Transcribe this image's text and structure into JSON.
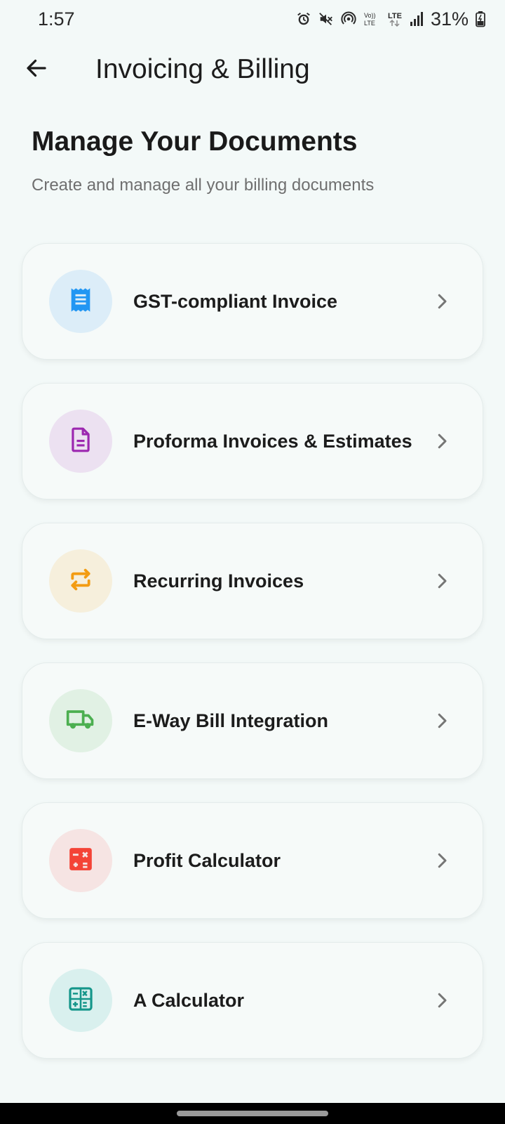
{
  "status_bar": {
    "time": "1:57",
    "battery": "31%",
    "icons": [
      "alarm-icon",
      "mute-icon",
      "hotspot-icon",
      "volte-icon",
      "lte-icon",
      "signal-icon",
      "battery-icon"
    ]
  },
  "app_bar": {
    "back_icon": "arrow-left-icon",
    "title": "Invoicing & Billing"
  },
  "header": {
    "title": "Manage Your Documents",
    "subtitle": "Create and manage all your billing documents"
  },
  "items": [
    {
      "label": "GST-compliant Invoice",
      "icon": "receipt-icon",
      "icon_color": "#2196f3",
      "bg_color": "#dcedf8"
    },
    {
      "label": "Proforma Invoices & Estimates",
      "icon": "document-icon",
      "icon_color": "#9c27b0",
      "bg_color": "#ece1f1"
    },
    {
      "label": "Recurring Invoices",
      "icon": "repeat-icon",
      "icon_color": "#f39c12",
      "bg_color": "#f6efdc"
    },
    {
      "label": "E-Way Bill Integration",
      "icon": "truck-icon",
      "icon_color": "#4caf50",
      "bg_color": "#e1f1e4"
    },
    {
      "label": "Profit Calculator",
      "icon": "calculator-icon",
      "icon_color": "#f44336",
      "bg_color": "#f6e4e3"
    },
    {
      "label": "A Calculator",
      "icon": "calculator-outline-icon",
      "icon_color": "#15968a",
      "bg_color": "#d9f0ee"
    }
  ],
  "colors": {
    "background": "#f3f9f8",
    "card": "#f6faf9",
    "chevron": "#757575"
  }
}
